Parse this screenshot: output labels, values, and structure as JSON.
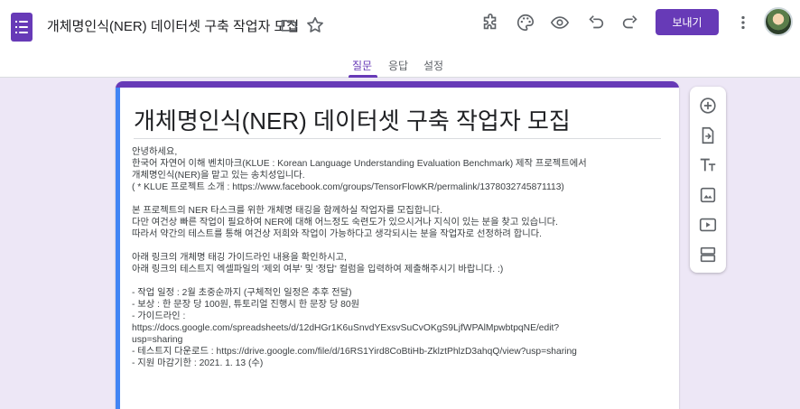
{
  "header": {
    "title": "개체명인식(NER) 데이터셋 구축 작업자 모집",
    "send_label": "보내기",
    "icons": [
      "folder-icon",
      "star-icon",
      "addon-icon",
      "palette-icon",
      "preview-eye-icon",
      "undo-icon",
      "redo-icon",
      "more-vert-icon"
    ]
  },
  "tabs": [
    {
      "label": "질문",
      "active": true
    },
    {
      "label": "응답",
      "active": false
    },
    {
      "label": "설정",
      "active": false
    }
  ],
  "form": {
    "title": "개체명인식(NER) 데이터셋 구축 작업자 모집",
    "description_lines": [
      "안녕하세요,",
      "한국어 자연어 이해 벤치마크(KLUE : Korean Language Understanding Evaluation Benchmark) 제작 프로젝트에서",
      "개체명인식(NER)을 맡고 있는 송치성입니다.",
      "( * KLUE 프로젝트 소개 : https://www.facebook.com/groups/TensorFlowKR/permalink/1378032745871113)",
      "",
      "본 프로젝트의 NER 타스크를 위한 개체명 태깅을 함께하실 작업자를 모집합니다.",
      "다만 여건상 빠른 작업이 필요하여 NER에 대해 어느정도 숙련도가 있으시거나 지식이 있는 분을 찾고 있습니다.",
      "따라서 약간의 테스트를 통해 여건상 저희와 작업이 가능하다고 생각되시는 분을 작업자로 선정하려 합니다.",
      "",
      "아래 링크의 개체명 태깅 가이드라인 내용을 확인하시고,",
      "아래 링크의 테스트지 엑셀파일의 '제외 여부' 및 '정답' 컬럼을 입력하여 제출해주시기 바랍니다. :)",
      "",
      "- 작업 일정 : 2월 초중순까지 (구체적인 일정은 추후 전달)",
      "- 보상 : 한 문장 당 100원, 튜토리얼 진행시 한 문장 당 80원",
      "- 가이드라인 :",
      "https://docs.google.com/spreadsheets/d/12dHGr1K6uSnvdYExsvSuCvOKgS9LjfWPAlMpwbtpqNE/edit?",
      "usp=sharing",
      "- 테스트지 다운로드 : https://drive.google.com/file/d/16RS1Yird8CoBtiHb-ZklztPhlzD3ahqQ/view?usp=sharing",
      "- 지원 마감기한 : 2021. 1. 13 (수)"
    ]
  },
  "side_toolbar": [
    "add-question-icon",
    "import-questions-icon",
    "add-title-icon",
    "add-image-icon",
    "add-video-icon",
    "add-section-icon"
  ],
  "colors": {
    "accent": "#673ab7",
    "focus_bar": "#4285f4",
    "background": "#ede7f6"
  }
}
